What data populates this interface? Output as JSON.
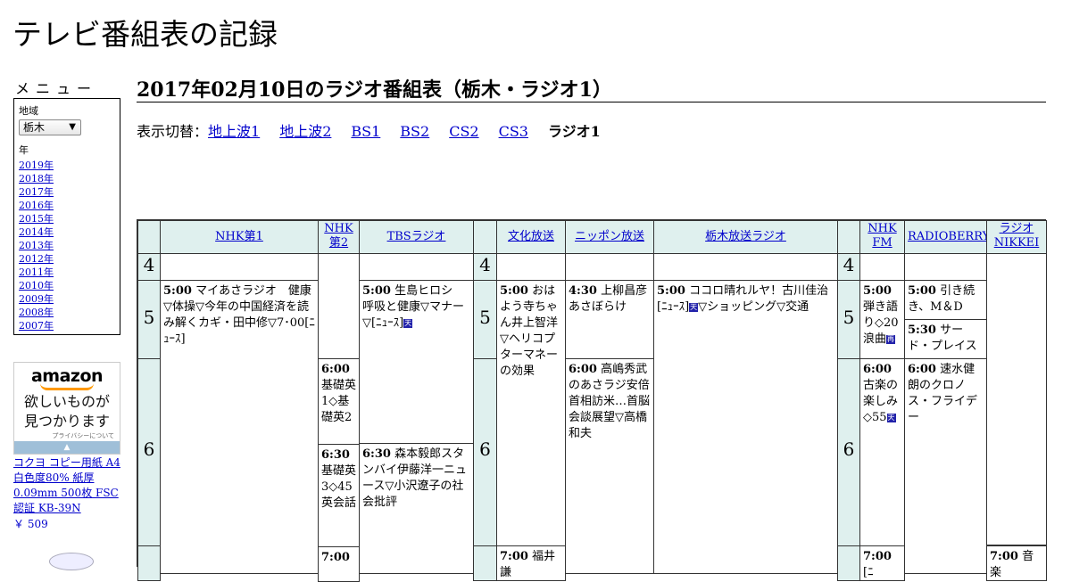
{
  "site": {
    "title": "テレビ番組表の記録"
  },
  "sidebar": {
    "menu_heading": "メニュー",
    "region_label": "地域",
    "region_value": "栃木",
    "year_label": "年",
    "years": [
      "2019年",
      "2018年",
      "2017年",
      "2016年",
      "2015年",
      "2014年",
      "2013年",
      "2012年",
      "2011年",
      "2010年",
      "2009年",
      "2008年",
      "2007年"
    ]
  },
  "ad": {
    "logo": "amazon",
    "text_line1": "欲しいものが",
    "text_line2": "見つかります",
    "privacy": "プライバシーについて",
    "product": "コクヨ コピー用紙 A4 白色度80% 紙厚 0.09mm 500枚 FSC認証 KB-39N",
    "price": "￥ 509"
  },
  "main": {
    "heading": "2017年02月10日のラジオ番組表（栃木・ラジオ1）",
    "switch_label": "表示切替：",
    "switch_links": [
      "地上波1",
      "地上波2",
      "BS1",
      "BS2",
      "CS2",
      "CS3"
    ],
    "switch_current": "ラジオ1"
  },
  "schedule": {
    "stations": [
      "NHK第1",
      "NHK第2",
      "TBSラジオ",
      "文化放送",
      "ニッポン放送",
      "栃木放送ラジオ",
      "NHK FM",
      "RADIOBERRY",
      "ラジオNIKKEI"
    ],
    "hours": [
      "4",
      "5",
      "6"
    ],
    "programs": {
      "nhk1_500": {
        "time": "5:00",
        "title": "マイあさラジオ　健康▽体操▽今年の中国経済を読み解くカギ・田中修▽7･00[ﾆｭｰｽ]"
      },
      "nhk2_600": {
        "time": "6:00",
        "title": "基礎英1◇基礎英2"
      },
      "nhk2_630": {
        "time": "6:30",
        "title": "基礎英3◇45英会話"
      },
      "nhk2_700": {
        "time": "7:00",
        "title": ""
      },
      "tbs_500": {
        "time": "5:00",
        "title": "生島ヒロシ　呼吸と健康▽マナー▽[ﾆｭｰｽ]",
        "tag": "天"
      },
      "tbs_630": {
        "time": "6:30",
        "title": "森本毅郎スタンバイ伊藤洋一ニュース▽小沢遼子の社会批評"
      },
      "bunka_500": {
        "time": "5:00",
        "title": "おはよう寺ちゃん井上智洋▽ヘリコプターマネーの効果"
      },
      "bunka_700": {
        "time": "7:00",
        "title": "福井謙"
      },
      "nippon_430": {
        "time": "4:30",
        "title": "上柳昌彦あさぼらけ"
      },
      "nippon_600": {
        "time": "6:00",
        "title": "高嶋秀武のあさラジ安倍首相訪米…首脳会談展望▽高橋和夫"
      },
      "tochigi_500": {
        "time": "5:00",
        "title": "ココロ晴れルヤ！古川佳治[ﾆｭｰｽ]",
        "tag": "天",
        "title2": "▽ショッピング▽交通"
      },
      "nhkfm_500": {
        "time": "5:00",
        "title": "弾き語り◇20浪曲",
        "tag": "再"
      },
      "nhkfm_600": {
        "time": "6:00",
        "title": "古楽の楽しみ◇55",
        "tag": "天"
      },
      "nhkfm_700": {
        "time": "7:00",
        "title": "[ﾆ"
      },
      "berry_500": {
        "time": "5:00",
        "title": "引き続き、M＆D"
      },
      "berry_530": {
        "time": "5:30",
        "title": "サード・プレイス"
      },
      "berry_600": {
        "time": "6:00",
        "title": "速水健朗のクロノス・フライデー"
      },
      "nikkei_700": {
        "time": "7:00",
        "title": "音楽"
      }
    }
  },
  "colors": {
    "header_bg": "#dff0ee",
    "link": "#0000cc"
  }
}
